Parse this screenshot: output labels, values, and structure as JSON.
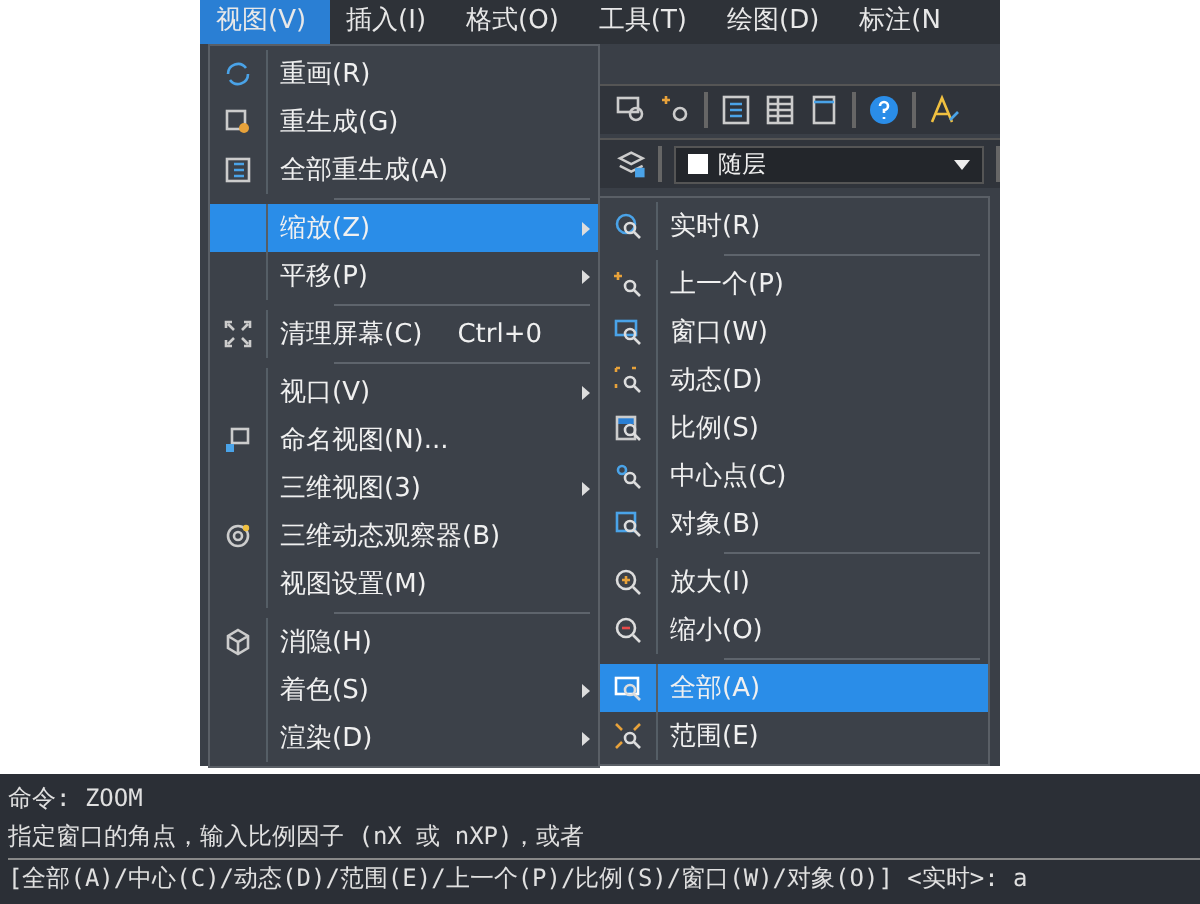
{
  "menu_bar": [
    {
      "label": "视图(V)",
      "selected": true
    },
    {
      "label": "插入(I)",
      "selected": false
    },
    {
      "label": "格式(O)",
      "selected": false
    },
    {
      "label": "工具(T)",
      "selected": false
    },
    {
      "label": "绘图(D)",
      "selected": false
    },
    {
      "label": "标注(N",
      "selected": false
    }
  ],
  "toolbar": {
    "layer_dropdown": "随层"
  },
  "view_menu": [
    {
      "kind": "item",
      "label": "重画(R)",
      "selected": false,
      "submenu": false
    },
    {
      "kind": "item",
      "label": "重生成(G)",
      "selected": false,
      "submenu": false
    },
    {
      "kind": "item",
      "label": "全部重生成(A)",
      "selected": false,
      "submenu": false
    },
    {
      "kind": "separator"
    },
    {
      "kind": "item",
      "label": "缩放(Z)",
      "selected": true,
      "submenu": true
    },
    {
      "kind": "item",
      "label": "平移(P)",
      "selected": false,
      "submenu": true
    },
    {
      "kind": "separator"
    },
    {
      "kind": "item",
      "label": "清理屏幕(C)",
      "shortcut": "Ctrl+0",
      "selected": false,
      "submenu": false
    },
    {
      "kind": "separator"
    },
    {
      "kind": "item",
      "label": "视口(V)",
      "selected": false,
      "submenu": true
    },
    {
      "kind": "item",
      "label": "命名视图(N)...",
      "selected": false,
      "submenu": false
    },
    {
      "kind": "item",
      "label": "三维视图(3)",
      "selected": false,
      "submenu": true
    },
    {
      "kind": "item",
      "label": "三维动态观察器(B)",
      "selected": false,
      "submenu": false
    },
    {
      "kind": "item",
      "label": "视图设置(M)",
      "selected": false,
      "submenu": false
    },
    {
      "kind": "separator"
    },
    {
      "kind": "item",
      "label": "消隐(H)",
      "selected": false,
      "submenu": false
    },
    {
      "kind": "item",
      "label": "着色(S)",
      "selected": false,
      "submenu": true
    },
    {
      "kind": "item",
      "label": "渲染(D)",
      "selected": false,
      "submenu": true
    }
  ],
  "zoom_submenu": [
    {
      "kind": "item",
      "label": "实时(R)",
      "selected": false
    },
    {
      "kind": "separator"
    },
    {
      "kind": "item",
      "label": "上一个(P)",
      "selected": false
    },
    {
      "kind": "item",
      "label": "窗口(W)",
      "selected": false
    },
    {
      "kind": "item",
      "label": "动态(D)",
      "selected": false
    },
    {
      "kind": "item",
      "label": "比例(S)",
      "selected": false
    },
    {
      "kind": "item",
      "label": "中心点(C)",
      "selected": false
    },
    {
      "kind": "item",
      "label": "对象(B)",
      "selected": false
    },
    {
      "kind": "separator"
    },
    {
      "kind": "item",
      "label": "放大(I)",
      "selected": false
    },
    {
      "kind": "item",
      "label": "缩小(O)",
      "selected": false
    },
    {
      "kind": "separator"
    },
    {
      "kind": "item",
      "label": "全部(A)",
      "selected": true
    },
    {
      "kind": "item",
      "label": "范围(E)",
      "selected": false
    }
  ],
  "command_line": [
    "命令: ZOOM",
    "指定窗口的角点，输入比例因子 (nX 或 nXP)，或者",
    "[全部(A)/中心(C)/动态(D)/范围(E)/上一个(P)/比例(S)/窗口(W)/对象(O)] <实时>: a"
  ]
}
